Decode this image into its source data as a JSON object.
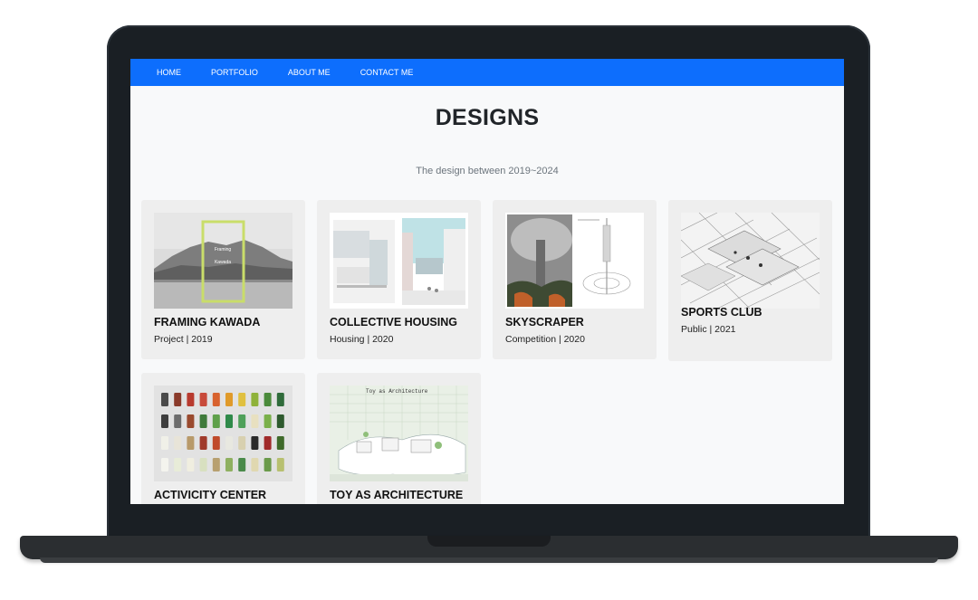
{
  "nav": {
    "items": [
      "HOME",
      "PORTFOLIO",
      "ABOUT ME",
      "CONTACT ME"
    ]
  },
  "page": {
    "title": "DESIGNS",
    "subtitle": "The design between 2019~2024"
  },
  "projects": [
    {
      "title": "FRAMING KAWADA",
      "meta": "Project | 2019",
      "overlay_line1": "Framing",
      "overlay_line2": "Kawada"
    },
    {
      "title": "COLLECTIVE HOUSING",
      "meta": "Housing | 2020"
    },
    {
      "title": "SKYSCRAPER",
      "meta": "Competition | 2020"
    },
    {
      "title": "SPORTS CLUB",
      "meta": "Public | 2021"
    },
    {
      "title": "ACTIVICITY CENTER",
      "meta": ""
    },
    {
      "title": "TOY AS ARCHITECTURE",
      "meta": "",
      "thumb_caption": "Toy as Architecture"
    }
  ],
  "colors": {
    "accent": "#0d6efd",
    "frame": "#c9dd6a"
  }
}
